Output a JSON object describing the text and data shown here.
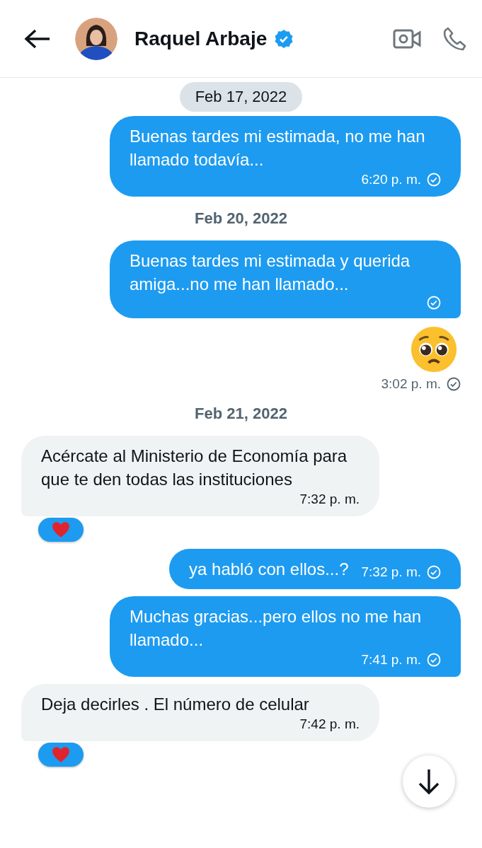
{
  "header": {
    "name": "Raquel Arbaje",
    "verified": true
  },
  "messages": [
    {
      "kind": "sent",
      "text": "Buenas tardes mi estimada, no me han llamado todavía...",
      "time": "6:20 p. m.",
      "overlay_date": "Feb 17, 2022"
    },
    {
      "kind": "date",
      "text": "Feb 20, 2022"
    },
    {
      "kind": "sent",
      "text": "Buenas tardes mi estimada y querida amiga...no me han llamado..."
    },
    {
      "kind": "emoji",
      "time": "3:02 p. m."
    },
    {
      "kind": "date",
      "text": "Feb 21, 2022"
    },
    {
      "kind": "received",
      "text": "Acércate al Ministerio de Economía para que te den todas las instituciones",
      "time": "7:32 p. m.",
      "reaction": true
    },
    {
      "kind": "sent",
      "text": "ya habló con ellos...?",
      "time": "7:32 p. m."
    },
    {
      "kind": "sent",
      "text": "Muchas gracias...pero ellos no me han llamado...",
      "time": "7:41 p. m."
    },
    {
      "kind": "received",
      "text": "Deja decirles . El número de celular",
      "time": "7:42 p. m.",
      "reaction": true
    }
  ]
}
